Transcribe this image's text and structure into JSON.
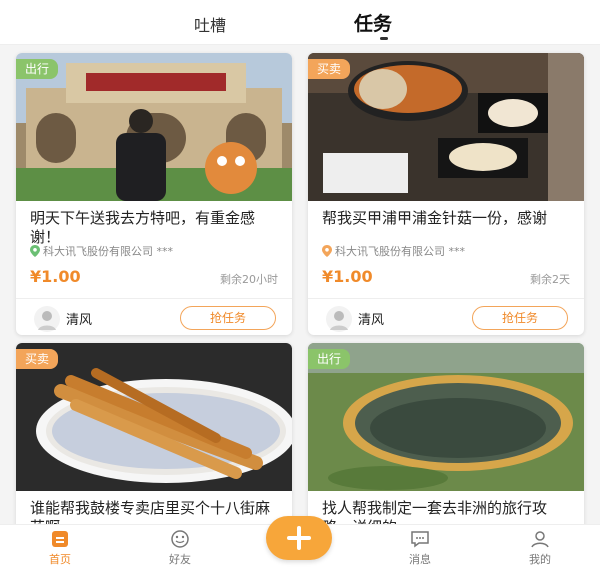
{
  "header": {
    "tabs": [
      "吐槽",
      "任务"
    ],
    "active_tab": "任务"
  },
  "cards": [
    {
      "tag": "出行",
      "title": "明天下午送我去方特吧，有重金感谢！",
      "company": "科大讯飞股份有限公司 ***",
      "price": "¥1.00",
      "remain": "剩余20小时",
      "user": "清风",
      "action": "抢任务"
    },
    {
      "tag": "买卖",
      "title": "帮我买甲浦甲浦金针菇一份，感谢",
      "company": "科大讯飞股份有限公司 ***",
      "price": "¥1.00",
      "remain": "剩余2天",
      "user": "清风",
      "action": "抢任务"
    },
    {
      "tag": "买卖",
      "title": "谁能帮我鼓楼专卖店里买个十八街麻花啊"
    },
    {
      "tag": "出行",
      "title": "找人帮我制定一套去非洲的旅行攻略，详细的"
    }
  ],
  "bottom_nav": [
    {
      "label": "首页",
      "icon": "home-icon",
      "active": true
    },
    {
      "label": "好友",
      "icon": "smile-icon"
    },
    {
      "label": "",
      "icon": "plus-icon"
    },
    {
      "label": "消息",
      "icon": "message-icon"
    },
    {
      "label": "我的",
      "icon": "person-icon"
    }
  ],
  "colors": {
    "accent": "#f08a2a",
    "tag_travel": "#8bc46a",
    "tag_trade": "#f3a55a"
  }
}
